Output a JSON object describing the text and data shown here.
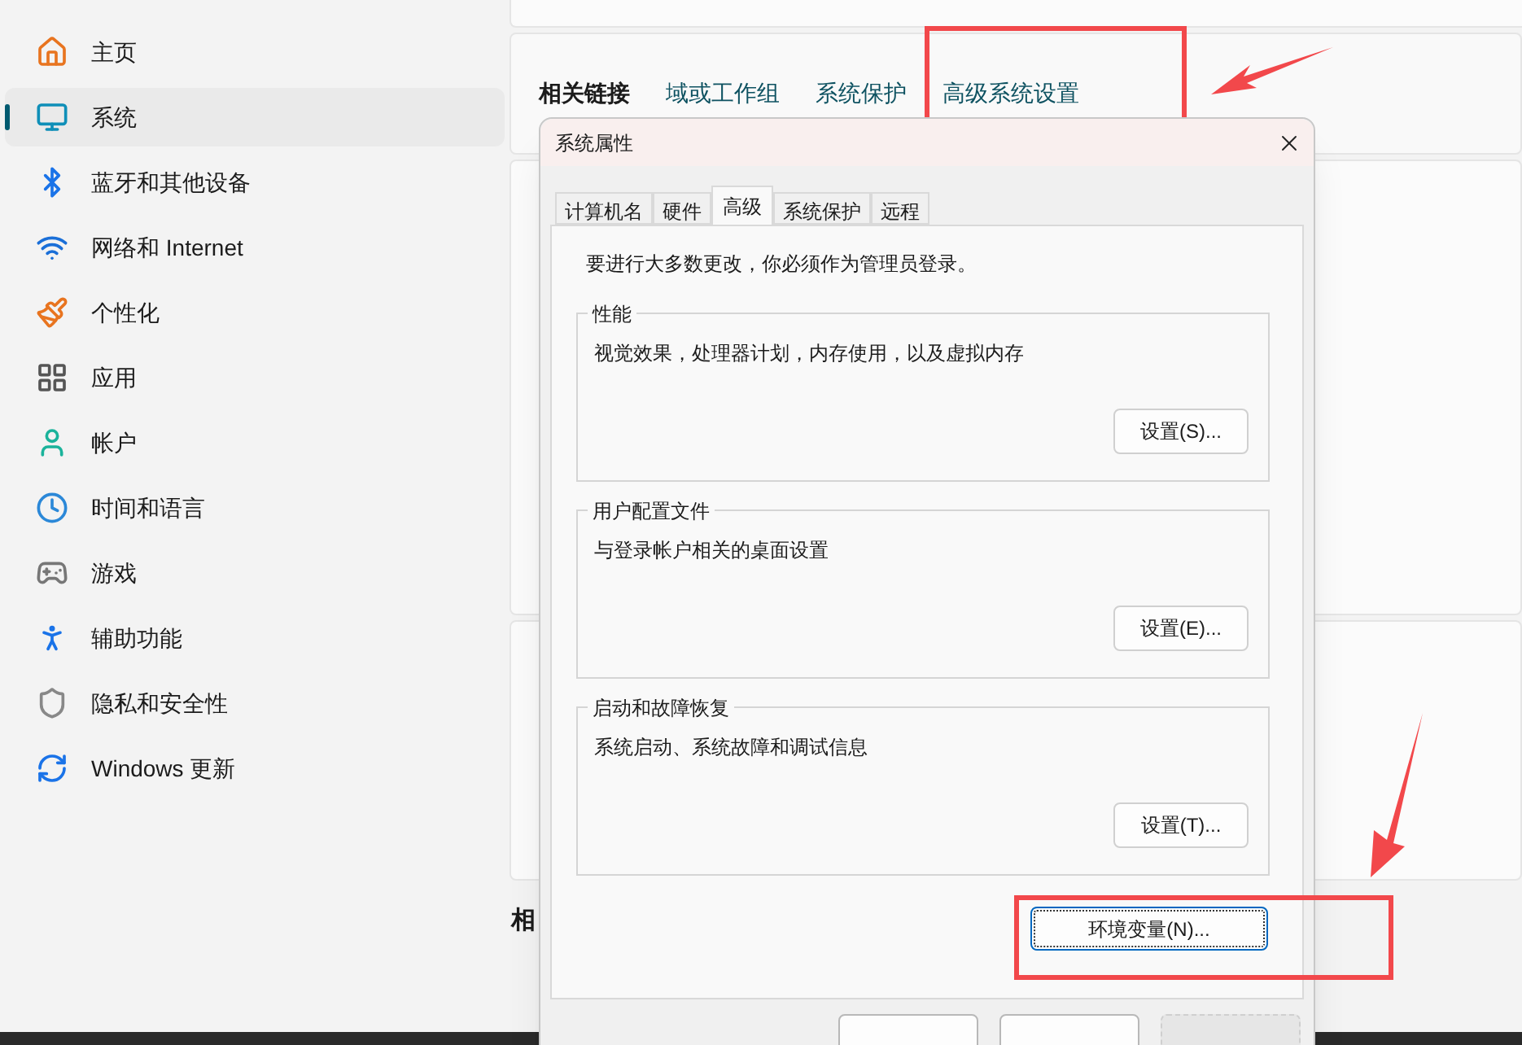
{
  "sidebar": {
    "items": [
      {
        "label": "主页",
        "selected": false
      },
      {
        "label": "系统",
        "selected": true
      },
      {
        "label": "蓝牙和其他设备",
        "selected": false
      },
      {
        "label": "网络和 Internet",
        "selected": false
      },
      {
        "label": "个性化",
        "selected": false
      },
      {
        "label": "应用",
        "selected": false
      },
      {
        "label": "帐户",
        "selected": false
      },
      {
        "label": "时间和语言",
        "selected": false
      },
      {
        "label": "游戏",
        "selected": false
      },
      {
        "label": "辅助功能",
        "selected": false
      },
      {
        "label": "隐私和安全性",
        "selected": false
      },
      {
        "label": "Windows 更新",
        "selected": false
      }
    ]
  },
  "related_links": {
    "title": "相关链接",
    "links": [
      "域或工作组",
      "系统保护",
      "高级系统设置"
    ]
  },
  "section_heading": "相",
  "dialog": {
    "title": "系统属性",
    "tabs": [
      {
        "label": "计算机名",
        "selected": false
      },
      {
        "label": "硬件",
        "selected": false
      },
      {
        "label": "高级",
        "selected": true
      },
      {
        "label": "系统保护",
        "selected": false
      },
      {
        "label": "远程",
        "selected": false
      }
    ],
    "notice": "要进行大多数更改，你必须作为管理员登录。",
    "groups": [
      {
        "title": "性能",
        "description": "视觉效果，处理器计划，内存使用，以及虚拟内存",
        "button": "设置(S)..."
      },
      {
        "title": "用户配置文件",
        "description": "与登录帐户相关的桌面设置",
        "button": "设置(E)..."
      },
      {
        "title": "启动和故障恢复",
        "description": "系统启动、系统故障和调试信息",
        "button": "设置(T)..."
      }
    ],
    "env_button": "环境变量(N)...",
    "footer_buttons": [
      {
        "disabled": false
      },
      {
        "disabled": false
      },
      {
        "disabled": true
      }
    ]
  }
}
